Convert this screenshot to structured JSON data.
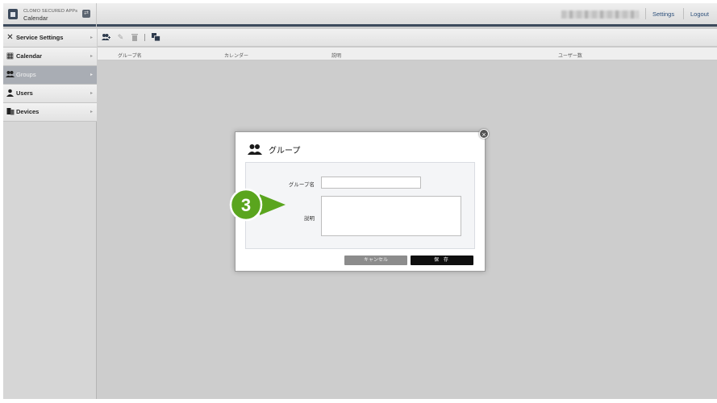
{
  "header": {
    "brand_sup": "CLOMO SECURED APPs",
    "app_name": "Calendar",
    "settings_link": "Settings",
    "logout_link": "Logout"
  },
  "sidebar": {
    "items": [
      {
        "label": "Service Settings",
        "icon": "tools-icon"
      },
      {
        "label": "Calendar",
        "icon": "calendar-icon"
      },
      {
        "label": "Groups",
        "icon": "groups-icon",
        "active": true
      },
      {
        "label": "Users",
        "icon": "user-icon"
      },
      {
        "label": "Devices",
        "icon": "devices-icon"
      }
    ]
  },
  "toolbar": {
    "icons": [
      "add-group-icon",
      "edit-icon",
      "delete-icon",
      "copy-icon"
    ]
  },
  "table": {
    "columns": [
      "グループ名",
      "カレンダー",
      "説明",
      "ユーザー数"
    ]
  },
  "dialog": {
    "title": "グループ",
    "name_label": "グループ名",
    "name_value": "",
    "desc_label": "説明",
    "desc_value": "",
    "cancel_label": "キャンセル",
    "save_label": "保 存"
  },
  "step_marker": {
    "number": "3",
    "color": "#5aa51e"
  }
}
